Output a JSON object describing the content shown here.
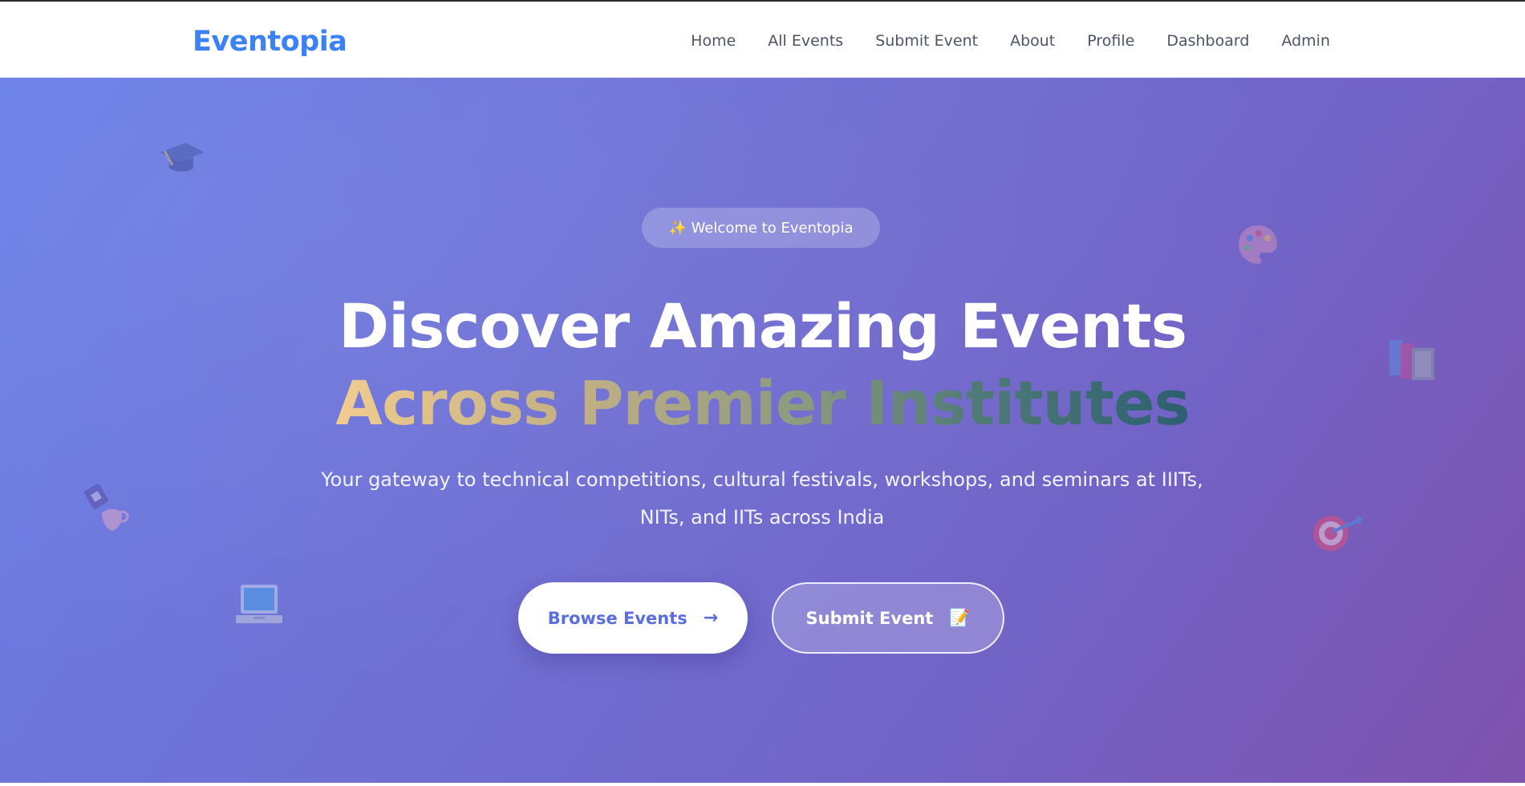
{
  "app": {
    "brand": "Eventopia"
  },
  "nav": {
    "items": [
      {
        "label": "Home"
      },
      {
        "label": "All Events"
      },
      {
        "label": "Submit Event"
      },
      {
        "label": "About"
      },
      {
        "label": "Profile"
      },
      {
        "label": "Dashboard"
      },
      {
        "label": "Admin"
      }
    ]
  },
  "hero": {
    "badge": "✨ Welcome to Eventopia",
    "title_line1": "Discover Amazing Events",
    "title_line2": "Across Premier Institutes",
    "subtitle": "Your gateway to technical competitions, cultural festivals, workshops, and seminars at IIITs, NITs, and IITs across India",
    "primary_button": {
      "label": "Browse Events",
      "icon": "→"
    },
    "secondary_button": {
      "label": "Submit Event",
      "icon": "📝"
    },
    "decorations": [
      "graduation-cap-icon",
      "palette-icon",
      "books-icon",
      "trophy-icon",
      "target-icon",
      "laptop-icon"
    ]
  },
  "colors": {
    "brand": "#3b82f6",
    "hero_gradient_start": "#6a80e8",
    "hero_gradient_end": "#7e52ad",
    "primary_button_text": "#5b6ee0"
  }
}
